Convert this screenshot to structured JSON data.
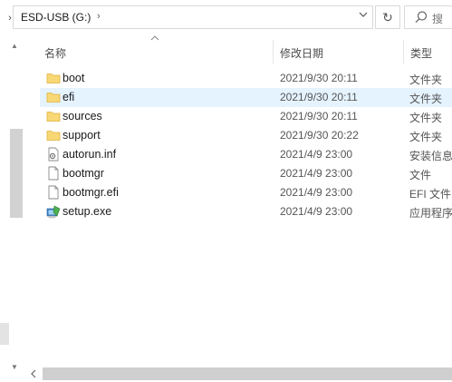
{
  "address_bar": {
    "path": "ESD-USB (G:)",
    "separator": "›",
    "search_placeholder": "搜"
  },
  "columns": {
    "name": "名称",
    "date": "修改日期",
    "type": "类型"
  },
  "files": [
    {
      "name": "boot",
      "date": "2021/9/30 20:11",
      "type": "文件夹",
      "icon": "folder-icon",
      "selected": false
    },
    {
      "name": "efi",
      "date": "2021/9/30 20:11",
      "type": "文件夹",
      "icon": "folder-icon",
      "selected": true
    },
    {
      "name": "sources",
      "date": "2021/9/30 20:11",
      "type": "文件夹",
      "icon": "folder-icon",
      "selected": false
    },
    {
      "name": "support",
      "date": "2021/9/30 20:22",
      "type": "文件夹",
      "icon": "folder-icon",
      "selected": false
    },
    {
      "name": "autorun.inf",
      "date": "2021/4/9 23:00",
      "type": "安装信息",
      "icon": "setup-info-icon",
      "selected": false
    },
    {
      "name": "bootmgr",
      "date": "2021/4/9 23:00",
      "type": "文件",
      "icon": "file-icon",
      "selected": false
    },
    {
      "name": "bootmgr.efi",
      "date": "2021/4/9 23:00",
      "type": "EFI 文件",
      "icon": "file-icon",
      "selected": false
    },
    {
      "name": "setup.exe",
      "date": "2021/4/9 23:00",
      "type": "应用程序",
      "icon": "setup-exe-icon",
      "selected": false
    }
  ],
  "colors": {
    "selected_row": "#e5f3ff",
    "folder": "#f8d775"
  }
}
